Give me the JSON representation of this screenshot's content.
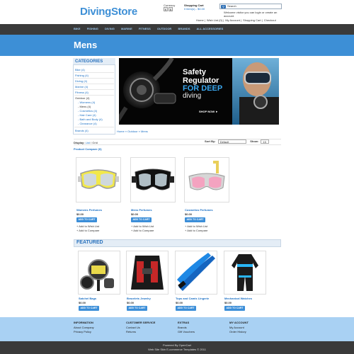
{
  "header": {
    "logo": "DivingStore",
    "currency_label": "Currency",
    "currency_options": [
      "€",
      "$"
    ],
    "cart_title": "Shopping Cart",
    "cart_summary": "0 item(s) - $0.00",
    "search_placeholder": "Search",
    "welcome": "Welcome visitor you can login or create an account.",
    "top_links": [
      "Home",
      "Wish List (0)",
      "My Account",
      "Shopping Cart",
      "Checkout"
    ]
  },
  "nav": {
    "items": [
      "BIKE",
      "FISHING",
      "DIVING",
      "MARINE",
      "FITNESS",
      "OUTDOOR",
      "BRANDS",
      "ALL ACCESSORIES"
    ]
  },
  "page": {
    "title": "Mens"
  },
  "sidebar": {
    "heading": "CATEGORIES",
    "items": [
      "Bike (4)",
      "Fishing (4)",
      "Diving (4)",
      "Marine (4)",
      "Fitness (4)",
      "Outdoor (4)"
    ],
    "subitems": [
      "- Womens (4)",
      "- Mens (4)",
      "- Cosmetics (4)",
      "- Hair Care (4)",
      "- Bath and Body (4)",
      "- Clearance (4)"
    ],
    "last_item": "Brands (4)"
  },
  "banner": {
    "line1": "Safety",
    "line2": "Regulator",
    "line3": "FOR DEEP",
    "line4": "diving",
    "cta": "SHOP NOW ►"
  },
  "breadcrumb": "Home » Outdoor » Mens",
  "toolbar": {
    "display_label": "Display:",
    "display_list": "List",
    "display_grid": "Grid",
    "sort_label": "Sort By:",
    "sort_value": "Default",
    "show_label": "Show:",
    "show_value": "15",
    "compare": "Product Compare (0)"
  },
  "products": [
    {
      "name": "Womens Perfumes",
      "price": "$0.00",
      "cart": "ADD TO CART",
      "wish": "+ Add to Wish List",
      "compare": "+ Add to Compare"
    },
    {
      "name": "Mens Perfumes",
      "price": "$0.00",
      "cart": "ADD TO CART",
      "wish": "+ Add to Wish List",
      "compare": "+ Add to Compare"
    },
    {
      "name": "Cosmetics Perfumes",
      "price": "$0.00",
      "cart": "ADD TO CART",
      "wish": "+ Add to Wish List",
      "compare": "+ Add to Compare"
    }
  ],
  "featured": {
    "heading": "FEATURED",
    "items": [
      {
        "name": "Satchel Bags",
        "price": "$0.00",
        "cart": "ADD TO CART"
      },
      {
        "name": "Bracelets Jewelry",
        "price": "$0.00",
        "cart": "ADD TO CART"
      },
      {
        "name": "Tops and Camis Lingerie",
        "price": "$0.00",
        "cart": "ADD TO CART"
      },
      {
        "name": "Mechanical Watches",
        "price": "$0.00",
        "cart": "ADD TO CART"
      }
    ]
  },
  "footer": {
    "columns": [
      {
        "heading": "INFORMATION",
        "items": [
          "About Company",
          "Privacy Policy"
        ]
      },
      {
        "heading": "CUSTOMER SERVICE",
        "items": [
          "Contact Us",
          "Returns"
        ]
      },
      {
        "heading": "EXTRAS",
        "items": [
          "Brands",
          "Gift Vouchers"
        ]
      },
      {
        "heading": "MY ACCOUNT",
        "items": [
          "My Account",
          "Order History"
        ]
      }
    ],
    "powered": "Powered By OpenCart",
    "copyright": "Web Site Skin E-commerce Templates © 2011"
  }
}
